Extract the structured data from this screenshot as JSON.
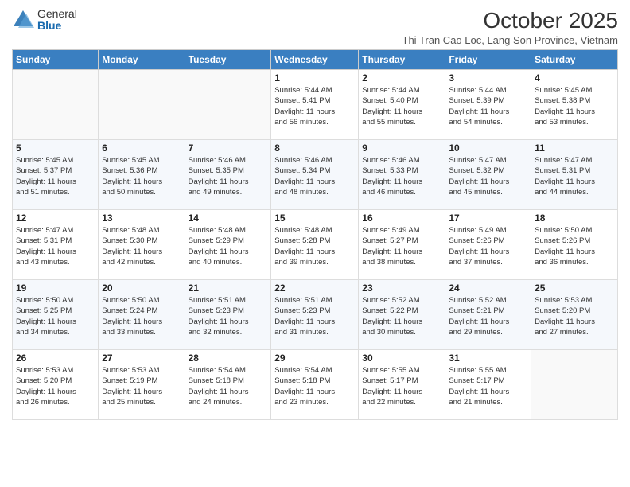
{
  "logo": {
    "general": "General",
    "blue": "Blue"
  },
  "title": "October 2025",
  "subtitle": "Thi Tran Cao Loc, Lang Son Province, Vietnam",
  "days_of_week": [
    "Sunday",
    "Monday",
    "Tuesday",
    "Wednesday",
    "Thursday",
    "Friday",
    "Saturday"
  ],
  "weeks": [
    [
      {
        "day": "",
        "info": ""
      },
      {
        "day": "",
        "info": ""
      },
      {
        "day": "",
        "info": ""
      },
      {
        "day": "1",
        "info": "Sunrise: 5:44 AM\nSunset: 5:41 PM\nDaylight: 11 hours\nand 56 minutes."
      },
      {
        "day": "2",
        "info": "Sunrise: 5:44 AM\nSunset: 5:40 PM\nDaylight: 11 hours\nand 55 minutes."
      },
      {
        "day": "3",
        "info": "Sunrise: 5:44 AM\nSunset: 5:39 PM\nDaylight: 11 hours\nand 54 minutes."
      },
      {
        "day": "4",
        "info": "Sunrise: 5:45 AM\nSunset: 5:38 PM\nDaylight: 11 hours\nand 53 minutes."
      }
    ],
    [
      {
        "day": "5",
        "info": "Sunrise: 5:45 AM\nSunset: 5:37 PM\nDaylight: 11 hours\nand 51 minutes."
      },
      {
        "day": "6",
        "info": "Sunrise: 5:45 AM\nSunset: 5:36 PM\nDaylight: 11 hours\nand 50 minutes."
      },
      {
        "day": "7",
        "info": "Sunrise: 5:46 AM\nSunset: 5:35 PM\nDaylight: 11 hours\nand 49 minutes."
      },
      {
        "day": "8",
        "info": "Sunrise: 5:46 AM\nSunset: 5:34 PM\nDaylight: 11 hours\nand 48 minutes."
      },
      {
        "day": "9",
        "info": "Sunrise: 5:46 AM\nSunset: 5:33 PM\nDaylight: 11 hours\nand 46 minutes."
      },
      {
        "day": "10",
        "info": "Sunrise: 5:47 AM\nSunset: 5:32 PM\nDaylight: 11 hours\nand 45 minutes."
      },
      {
        "day": "11",
        "info": "Sunrise: 5:47 AM\nSunset: 5:31 PM\nDaylight: 11 hours\nand 44 minutes."
      }
    ],
    [
      {
        "day": "12",
        "info": "Sunrise: 5:47 AM\nSunset: 5:31 PM\nDaylight: 11 hours\nand 43 minutes."
      },
      {
        "day": "13",
        "info": "Sunrise: 5:48 AM\nSunset: 5:30 PM\nDaylight: 11 hours\nand 42 minutes."
      },
      {
        "day": "14",
        "info": "Sunrise: 5:48 AM\nSunset: 5:29 PM\nDaylight: 11 hours\nand 40 minutes."
      },
      {
        "day": "15",
        "info": "Sunrise: 5:48 AM\nSunset: 5:28 PM\nDaylight: 11 hours\nand 39 minutes."
      },
      {
        "day": "16",
        "info": "Sunrise: 5:49 AM\nSunset: 5:27 PM\nDaylight: 11 hours\nand 38 minutes."
      },
      {
        "day": "17",
        "info": "Sunrise: 5:49 AM\nSunset: 5:26 PM\nDaylight: 11 hours\nand 37 minutes."
      },
      {
        "day": "18",
        "info": "Sunrise: 5:50 AM\nSunset: 5:26 PM\nDaylight: 11 hours\nand 36 minutes."
      }
    ],
    [
      {
        "day": "19",
        "info": "Sunrise: 5:50 AM\nSunset: 5:25 PM\nDaylight: 11 hours\nand 34 minutes."
      },
      {
        "day": "20",
        "info": "Sunrise: 5:50 AM\nSunset: 5:24 PM\nDaylight: 11 hours\nand 33 minutes."
      },
      {
        "day": "21",
        "info": "Sunrise: 5:51 AM\nSunset: 5:23 PM\nDaylight: 11 hours\nand 32 minutes."
      },
      {
        "day": "22",
        "info": "Sunrise: 5:51 AM\nSunset: 5:23 PM\nDaylight: 11 hours\nand 31 minutes."
      },
      {
        "day": "23",
        "info": "Sunrise: 5:52 AM\nSunset: 5:22 PM\nDaylight: 11 hours\nand 30 minutes."
      },
      {
        "day": "24",
        "info": "Sunrise: 5:52 AM\nSunset: 5:21 PM\nDaylight: 11 hours\nand 29 minutes."
      },
      {
        "day": "25",
        "info": "Sunrise: 5:53 AM\nSunset: 5:20 PM\nDaylight: 11 hours\nand 27 minutes."
      }
    ],
    [
      {
        "day": "26",
        "info": "Sunrise: 5:53 AM\nSunset: 5:20 PM\nDaylight: 11 hours\nand 26 minutes."
      },
      {
        "day": "27",
        "info": "Sunrise: 5:53 AM\nSunset: 5:19 PM\nDaylight: 11 hours\nand 25 minutes."
      },
      {
        "day": "28",
        "info": "Sunrise: 5:54 AM\nSunset: 5:18 PM\nDaylight: 11 hours\nand 24 minutes."
      },
      {
        "day": "29",
        "info": "Sunrise: 5:54 AM\nSunset: 5:18 PM\nDaylight: 11 hours\nand 23 minutes."
      },
      {
        "day": "30",
        "info": "Sunrise: 5:55 AM\nSunset: 5:17 PM\nDaylight: 11 hours\nand 22 minutes."
      },
      {
        "day": "31",
        "info": "Sunrise: 5:55 AM\nSunset: 5:17 PM\nDaylight: 11 hours\nand 21 minutes."
      },
      {
        "day": "",
        "info": ""
      }
    ]
  ]
}
